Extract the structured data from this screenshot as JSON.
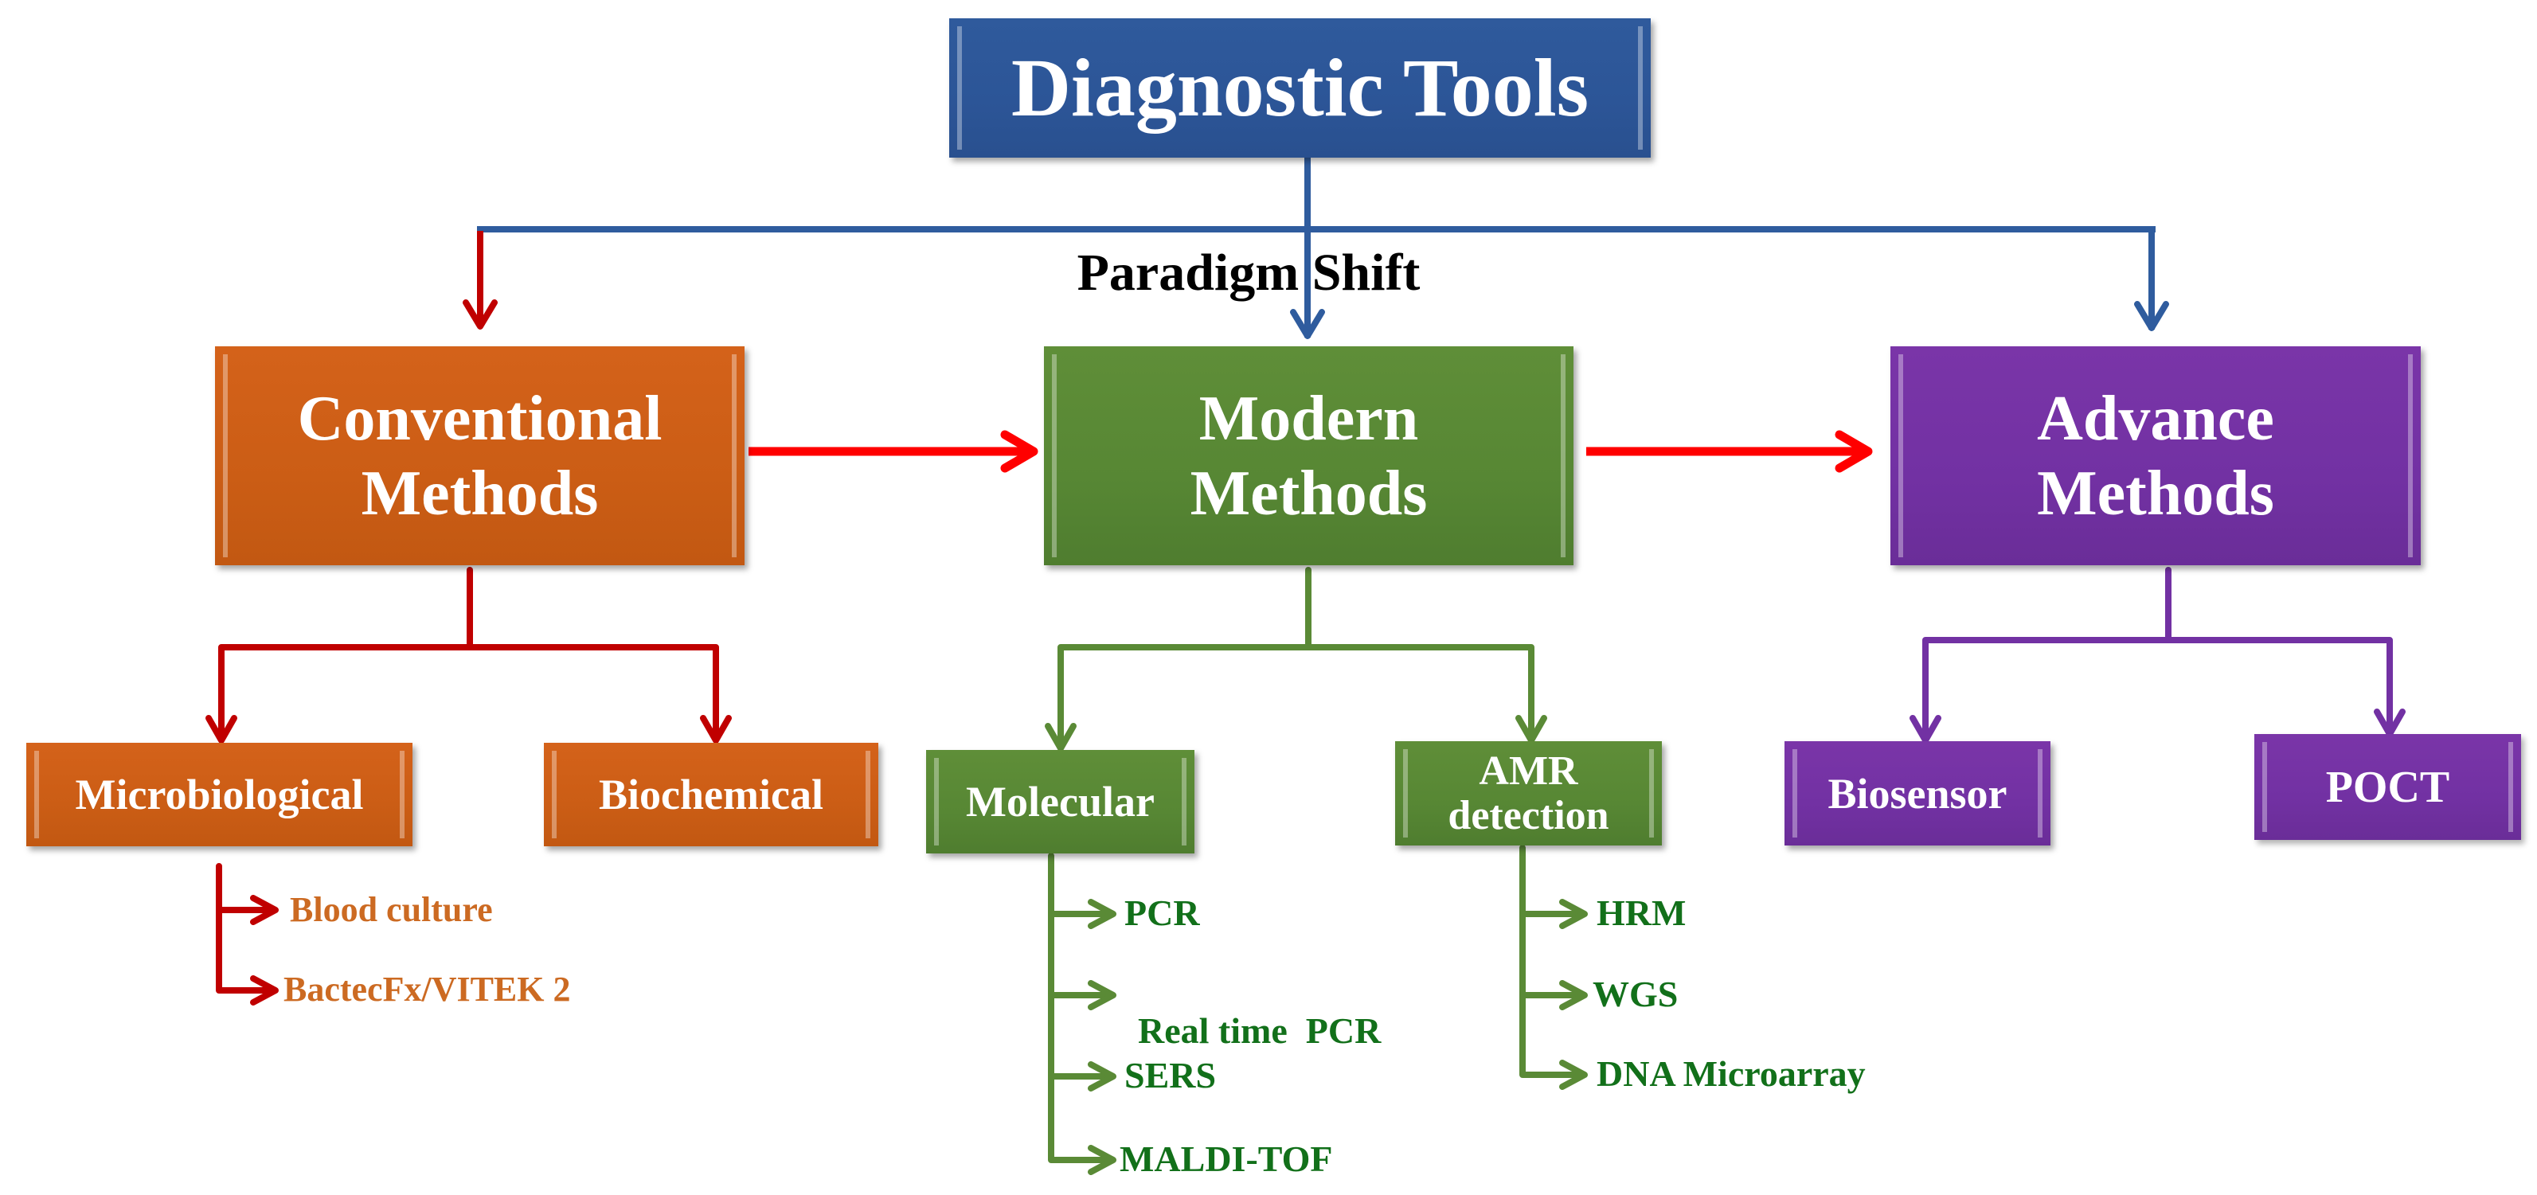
{
  "diagram": {
    "title": "Diagnostic Tools",
    "transition_label": "Paradigm Shift",
    "colors": {
      "title_blue": "#2c5597",
      "connector_blue": "#2f5c9e",
      "conventional_orange": "#cb5d15",
      "modern_green": "#578734",
      "advance_purple": "#7231a3",
      "arrow_red": "#ff0000",
      "branch_red": "#c00000",
      "list_orange_text": "#cc6a22",
      "list_green_text": "#12701a"
    },
    "categories": [
      {
        "id": "conventional",
        "line1": "Conventional",
        "line2": "Methods",
        "subcategories": [
          {
            "label": "Microbiological",
            "items": [
              "Blood culture",
              "BactecFx/VITEK 2"
            ]
          },
          {
            "label": "Biochemical",
            "items": []
          }
        ]
      },
      {
        "id": "modern",
        "line1": "Modern",
        "line2": "Methods",
        "subcategories": [
          {
            "label": "Molecular",
            "items": [
              "PCR",
              "Real time  PCR",
              "SERS",
              "MALDI-TOF"
            ]
          },
          {
            "label_line1": "AMR",
            "label_line2": "detection",
            "items": [
              "HRM",
              "WGS",
              "DNA Microarray"
            ]
          }
        ]
      },
      {
        "id": "advance",
        "line1": "Advance",
        "line2": "Methods",
        "subcategories": [
          {
            "label": "Biosensor",
            "items": []
          },
          {
            "label": "POCT",
            "items": []
          }
        ]
      }
    ],
    "flow": [
      "Conventional Methods",
      "Modern Methods",
      "Advance Methods"
    ]
  }
}
